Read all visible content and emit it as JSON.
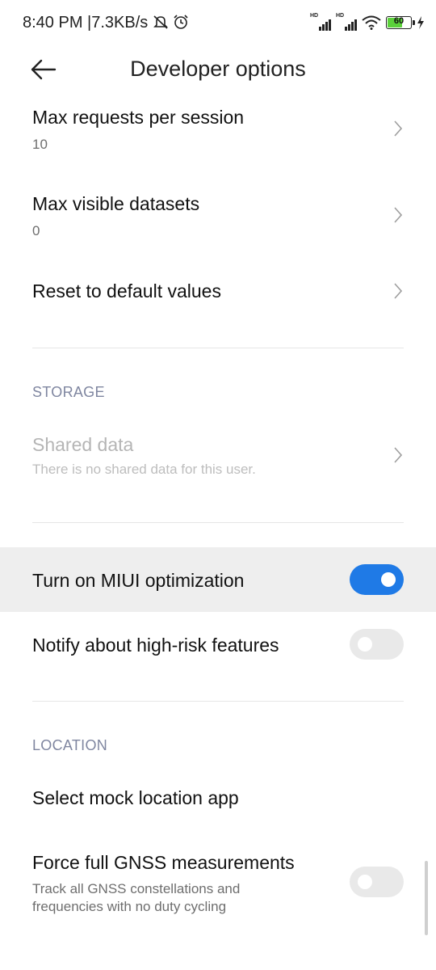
{
  "status": {
    "time": "8:40 PM",
    "speed": "7.3KB/s",
    "sim1_label": "HD",
    "sim2_label": "HD",
    "battery": "60"
  },
  "header": {
    "title": "Developer options"
  },
  "rows": {
    "max_requests": {
      "title": "Max requests per session",
      "value": "10"
    },
    "max_visible": {
      "title": "Max visible datasets",
      "value": "0"
    },
    "reset": {
      "title": "Reset to default values"
    },
    "storage_header": "STORAGE",
    "shared_data": {
      "title": "Shared data",
      "subtitle": "There is no shared data for this user."
    },
    "miui": {
      "title": "Turn on MIUI optimization",
      "enabled": true
    },
    "notify": {
      "title": "Notify about high-risk features",
      "enabled": false
    },
    "location_header": "LOCATION",
    "mock_location": {
      "title": "Select mock location app"
    },
    "gnss": {
      "title": "Force full GNSS measurements",
      "subtitle_line1": "Track all GNSS constellations and",
      "subtitle_line2": "frequencies with no duty cycling",
      "enabled": false
    }
  },
  "colors": {
    "accent": "#1f7ae6",
    "highlight": "#eeeeee",
    "section": "#7f86a0"
  }
}
